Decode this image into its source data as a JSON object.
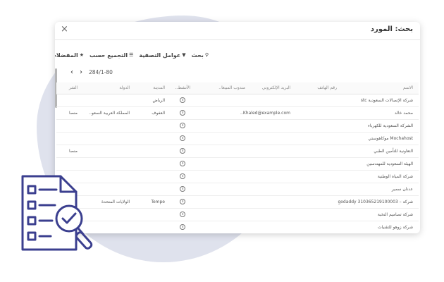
{
  "modal": {
    "title": "بحث: المورد",
    "close_symbol": "×"
  },
  "toolbar": {
    "search": "بحث",
    "filters": "عوامل التصفية",
    "group_by": "التجميع حسب",
    "favorites": "المفضلات"
  },
  "pager": {
    "range": "284/1-80"
  },
  "table": {
    "columns": [
      "الاسم",
      "رقم الهاتف",
      "البريد الإلكتروني",
      "مندوب المبيعا..",
      "الأنشط..",
      "المدينة",
      "الدولة",
      "الشر"
    ],
    "rows": [
      {
        "name": "شركة الإتصالات السعودية stc",
        "email": "",
        "city": "الرياض",
        "country": "",
        "company": ""
      },
      {
        "name": "محمد خالد",
        "email": "Khaled@example.com..",
        "city": "العفوف",
        "country": "المملكة العربية السعو..",
        "company": "منصا"
      },
      {
        "name": "الشركة السعودية للكهرباء",
        "email": "",
        "city": "",
        "country": "",
        "company": ""
      },
      {
        "name": "Mochahost موكاهوستي",
        "email": "",
        "city": "",
        "country": "",
        "company": ""
      },
      {
        "name": "التعاونية للتأمين الطبي",
        "email": "",
        "city": "",
        "country": "",
        "company": "منصا"
      },
      {
        "name": "الهيئة السعودية للمهندسين",
        "email": "",
        "city": "",
        "country": "",
        "company": ""
      },
      {
        "name": "شركة المياه الوطنية",
        "email": "",
        "city": "",
        "country": "",
        "company": ""
      },
      {
        "name": "عدنان سمير",
        "email": "",
        "city": "",
        "country": "",
        "company": ""
      },
      {
        "name": "شركة – 310365219100003 godaddy",
        "email": "",
        "city": "Tempe",
        "country": "الولايات المتحدة",
        "company": ""
      },
      {
        "name": "شركة تصاميم النخبة",
        "email": "",
        "city": "",
        "country": "",
        "company": ""
      },
      {
        "name": "شركة زوهو للتقنيات",
        "email": "",
        "city": "",
        "country": "",
        "company": ""
      }
    ]
  },
  "colors": {
    "blob": "#dfe2ed",
    "icon": "#3b3f8f"
  },
  "icons": {
    "search": "magnifier-icon",
    "filter": "funnel-icon",
    "group": "layers-icon",
    "favorite": "star-icon",
    "activity": "clock-icon"
  }
}
